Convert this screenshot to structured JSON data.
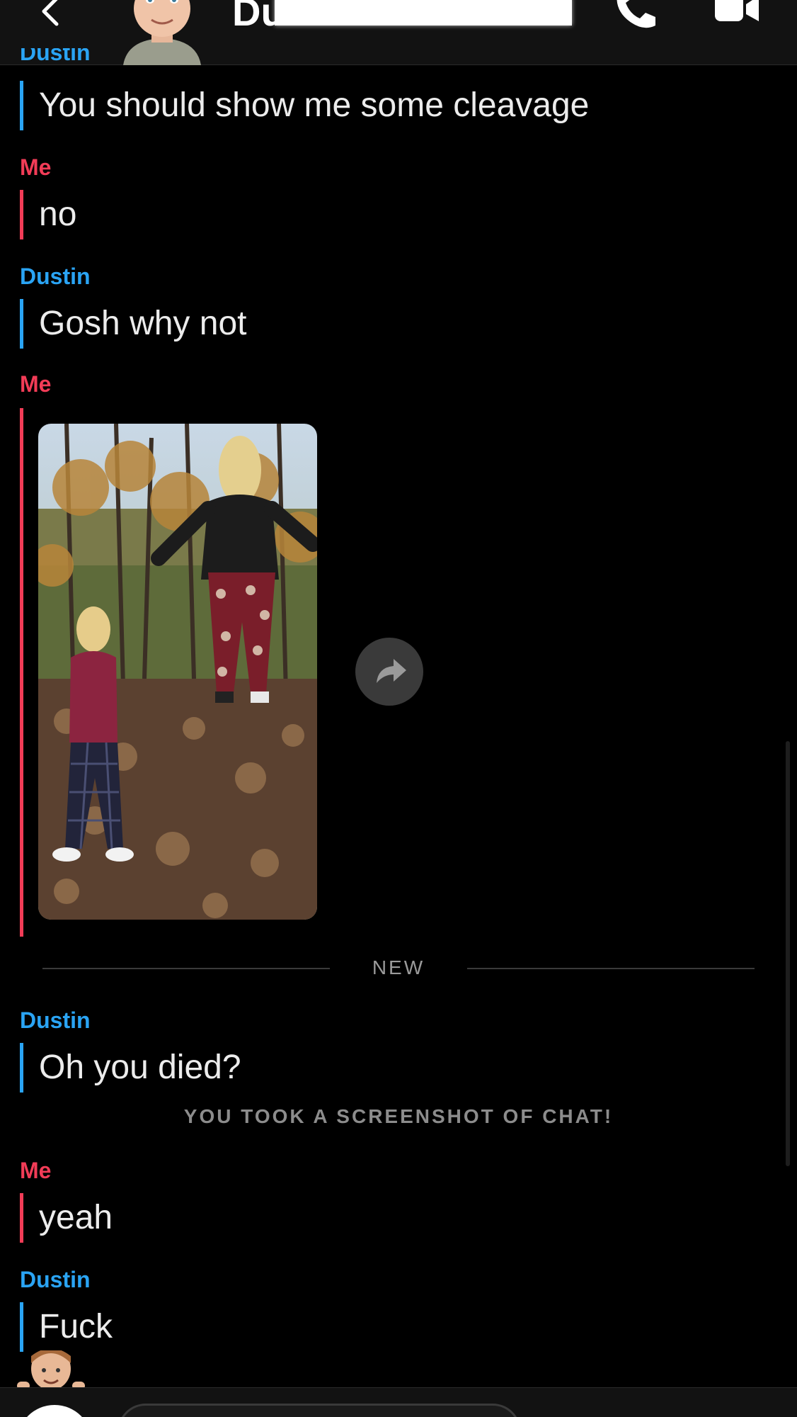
{
  "header": {
    "title": "Du",
    "back_icon": "chevron-left-icon",
    "call_icon": "phone-icon",
    "video_icon": "video-camera-icon"
  },
  "messages": [
    {
      "sender": "Dustin",
      "text": "You should show me some cleavage"
    },
    {
      "sender": "Me",
      "text": "no"
    },
    {
      "sender": "Dustin",
      "text": "Gosh why not"
    },
    {
      "sender": "Me",
      "media": "photo"
    },
    {
      "sender": "Dustin",
      "text": "Oh you died?"
    },
    {
      "sender": "Me",
      "text": "yeah"
    },
    {
      "sender": "Dustin",
      "text": "Fuck"
    }
  ],
  "labels": {
    "cut_sender": "Dustin",
    "new_divider": "NEW",
    "screenshot_notice": "YOU TOOK A SCREENSHOT OF CHAT!"
  },
  "colors": {
    "friend": "#2aa4f4",
    "me": "#f23c57",
    "background": "#000000"
  }
}
